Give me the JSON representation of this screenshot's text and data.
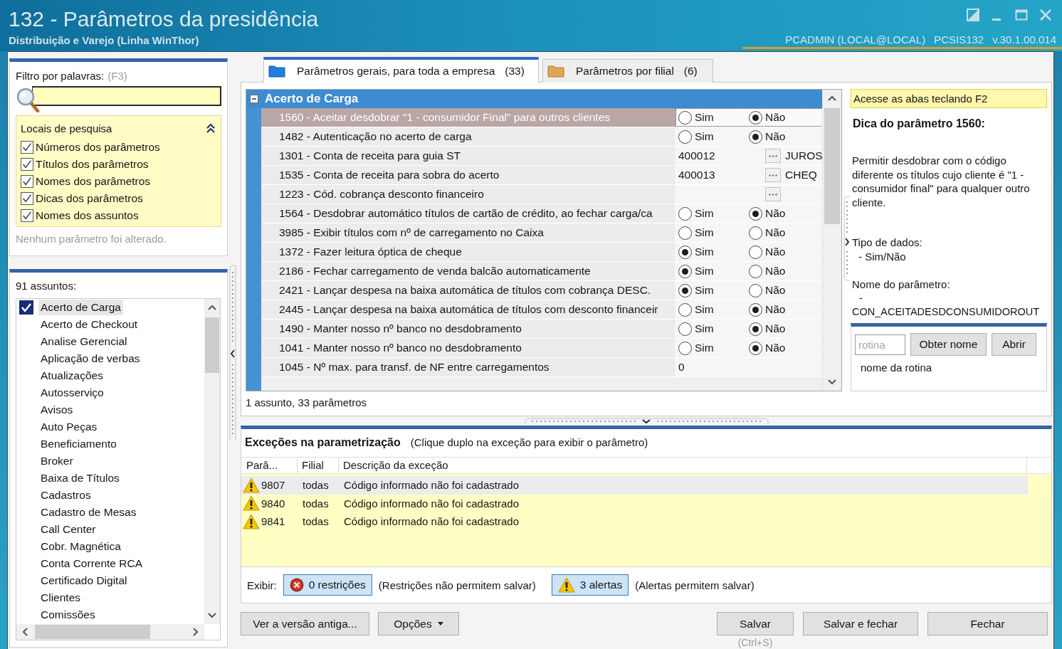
{
  "window": {
    "title": "132 - Parâmetros da presidência",
    "subtitle": "Distribuição e Varejo (Linha WinThor)",
    "user": "PCADMIN (LOCAL@LOCAL)",
    "routine": "PCSIS132",
    "version": "v.30.1.00.014"
  },
  "filter": {
    "label": "Filtro por palavras:",
    "shortcut": "(F3)"
  },
  "search_locations": {
    "title": "Locais de pesquisa",
    "expanded": true,
    "options": [
      {
        "label": "Números dos parâmetros",
        "checked": true
      },
      {
        "label": "Títulos dos parâmetros",
        "checked": true
      },
      {
        "label": "Nomes dos parâmetros",
        "checked": true
      },
      {
        "label": "Dicas dos parâmetros",
        "checked": true
      },
      {
        "label": "Nomes dos assuntos",
        "checked": true
      }
    ]
  },
  "change_status": "Nenhum parâmetro foi alterado.",
  "subjects": {
    "count_label": "91 assuntos:",
    "items": [
      {
        "label": "Acerto de Carga",
        "checked": true,
        "selected": true
      },
      {
        "label": "Acerto de Checkout",
        "checked": false,
        "selected": false
      },
      {
        "label": "Analise Gerencial",
        "checked": false,
        "selected": false
      },
      {
        "label": "Aplicação de verbas",
        "checked": false,
        "selected": false
      },
      {
        "label": "Atualizações",
        "checked": false,
        "selected": false
      },
      {
        "label": "Autosserviço",
        "checked": false,
        "selected": false
      },
      {
        "label": "Avisos",
        "checked": false,
        "selected": false
      },
      {
        "label": "Auto Peças",
        "checked": false,
        "selected": false
      },
      {
        "label": "Beneficiamento",
        "checked": false,
        "selected": false
      },
      {
        "label": "Broker",
        "checked": false,
        "selected": false
      },
      {
        "label": "Baixa de Títulos",
        "checked": false,
        "selected": false
      },
      {
        "label": "Cadastros",
        "checked": false,
        "selected": false
      },
      {
        "label": "Cadastro de Mesas",
        "checked": false,
        "selected": false
      },
      {
        "label": "Call Center",
        "checked": false,
        "selected": false
      },
      {
        "label": "Cobr. Magnética",
        "checked": false,
        "selected": false
      },
      {
        "label": "Conta Corrente RCA",
        "checked": false,
        "selected": false
      },
      {
        "label": "Certificado Digital",
        "checked": false,
        "selected": false
      },
      {
        "label": "Clientes",
        "checked": false,
        "selected": false
      },
      {
        "label": "Comissões",
        "checked": false,
        "selected": false
      }
    ]
  },
  "tabs": [
    {
      "label": "Parâmetros gerais, para toda a empresa",
      "count": "(33)",
      "selected": true
    },
    {
      "label": "Parâmetros por filial",
      "count": "(6)",
      "selected": false
    }
  ],
  "parameters": {
    "group": {
      "title": "Acerto de Carga",
      "expanded": true
    },
    "rows": [
      {
        "label": "1560 - Aceitar desdobrar \"1 - consumidor Final\" para outros clientes",
        "selected": true,
        "kind": "yesno",
        "options": [
          {
            "label": "Sim",
            "selected": false
          },
          {
            "label": "Não",
            "selected": true
          }
        ]
      },
      {
        "label": "1482 - Autenticação no acerto de carga",
        "selected": false,
        "kind": "yesno",
        "options": [
          {
            "label": "Sim",
            "selected": false
          },
          {
            "label": "Não",
            "selected": true
          }
        ]
      },
      {
        "label": "1301 - Conta de receita para guia ST",
        "selected": false,
        "kind": "lookup",
        "value": "400012",
        "description": "JUROS"
      },
      {
        "label": "1535 - Conta de receita para sobra do acerto",
        "selected": false,
        "kind": "lookup",
        "value": "400013",
        "description": "CHEQ"
      },
      {
        "label": "1223 - Cód. cobrança desconto financeiro",
        "selected": false,
        "kind": "lookup"
      },
      {
        "label": "1564 - Desdobrar automático títulos de cartão de crédito, ao fechar carga/ca",
        "selected": false,
        "kind": "yesno",
        "options": [
          {
            "label": "Sim",
            "selected": false
          },
          {
            "label": "Não",
            "selected": true
          }
        ]
      },
      {
        "label": "3985 - Exibir títulos com nº de carregamento no Caixa",
        "selected": false,
        "kind": "yesno",
        "options": [
          {
            "label": "Sim",
            "selected": false
          },
          {
            "label": "Não",
            "selected": false
          }
        ]
      },
      {
        "label": "1372 - Fazer leitura óptica de cheque",
        "selected": false,
        "kind": "yesno",
        "options": [
          {
            "label": "Sim",
            "selected": true
          },
          {
            "label": "Não",
            "selected": false
          }
        ]
      },
      {
        "label": "2186 - Fechar carregamento de venda balcão automaticamente",
        "selected": false,
        "kind": "yesno",
        "options": [
          {
            "label": "Sim",
            "selected": true
          },
          {
            "label": "Não",
            "selected": false
          }
        ]
      },
      {
        "label": "2421 - Lançar despesa na baixa automática de títulos com cobrança DESC.",
        "selected": false,
        "kind": "yesno",
        "options": [
          {
            "label": "Sim",
            "selected": true
          },
          {
            "label": "Não",
            "selected": false
          }
        ]
      },
      {
        "label": "2445 - Lançar despesa na baixa automática de títulos com desconto financeir",
        "selected": false,
        "kind": "yesno",
        "options": [
          {
            "label": "Sim",
            "selected": false
          },
          {
            "label": "Não",
            "selected": true
          }
        ]
      },
      {
        "label": "1490 - Manter nosso nº banco no desdobramento",
        "selected": false,
        "kind": "yesno",
        "options": [
          {
            "label": "Sim",
            "selected": false
          },
          {
            "label": "Não",
            "selected": true
          }
        ]
      },
      {
        "label": "1041 - Manter nosso nº banco no desdobramento",
        "selected": false,
        "kind": "yesno",
        "options": [
          {
            "label": "Sim",
            "selected": false
          },
          {
            "label": "Não",
            "selected": true
          }
        ]
      },
      {
        "label": "1045 - Nº max. para transf. de NF entre carregamentos",
        "selected": false,
        "kind": "number",
        "value": "0"
      }
    ],
    "summary": "1 assunto, 33 parâmetros"
  },
  "hint": {
    "banner": "Acesse as abas teclando F2",
    "title": "Dica do parâmetro 1560:",
    "description": "Permitir desdobrar com o código diferente os títulos cujo cliente é \"1 - consumidor final\" para qualquer outro cliente.",
    "data_type_label": "Tipo de dados:",
    "data_type": "- Sim/Não",
    "name_label": "Nome do parâmetro:",
    "name": "- CON_ACEITADESDCONSUMIDOROUT"
  },
  "routine_lookup": {
    "input": {
      "placeholder": "rotina"
    },
    "buttons": [
      "Obter nome",
      "Abrir"
    ],
    "result": "nome da rotina"
  },
  "exceptions": {
    "title": "Exceções na parametrização",
    "hint": "(Clique duplo na exceção para exibir o parâmetro)",
    "columns": [
      "Parâ...",
      "Filial",
      "Descrição da exceção"
    ],
    "rows": [
      {
        "kind": "alert",
        "parameter": "9807",
        "branch": "todas",
        "description": "Código informado não foi cadastrado",
        "selected": true
      },
      {
        "kind": "alert",
        "parameter": "9840",
        "branch": "todas",
        "description": "Código informado não foi cadastrado",
        "selected": false
      },
      {
        "kind": "alert",
        "parameter": "9841",
        "branch": "todas",
        "description": "Código informado não foi cadastrado",
        "selected": false
      }
    ],
    "filter_label": "Exibir:",
    "filters": [
      {
        "kind": "restriction",
        "label": "0 restrições",
        "note": "(Restrições não permitem salvar)",
        "pressed": true
      },
      {
        "kind": "alert",
        "label": "3 alertas",
        "note": "(Alertas permitem salvar)",
        "pressed": true
      }
    ]
  },
  "footer": {
    "left": [
      {
        "label": "Ver a versão antiga...",
        "kind": "plain"
      },
      {
        "label": "Opções",
        "kind": "menu"
      }
    ],
    "right": [
      {
        "label": "Salvar",
        "kind": "plain",
        "shortcut": "(Ctrl+S)"
      },
      {
        "label": "Salvar e fechar",
        "kind": "plain"
      },
      {
        "label": "Fechar",
        "kind": "plain"
      }
    ]
  }
}
